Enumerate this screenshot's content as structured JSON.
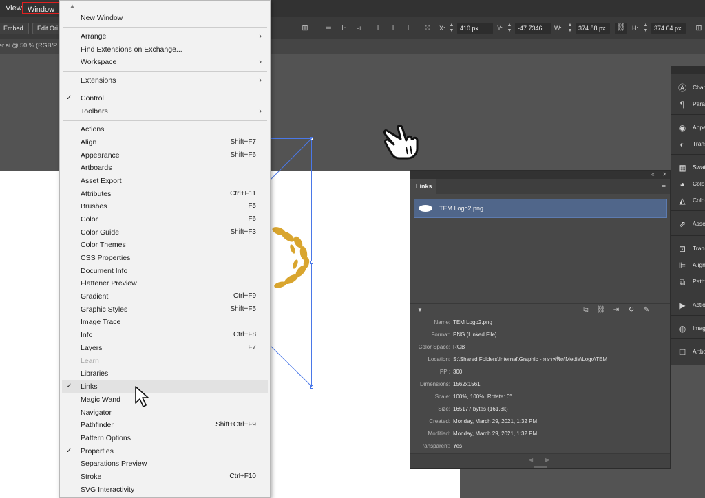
{
  "menubar": {
    "view_label": "View",
    "window_label": "Window"
  },
  "controlbar": {
    "embed_label": "Embed",
    "edit_original_label": "Edit Ori",
    "x_label": "X:",
    "x_value": "410 px",
    "y_label": "Y:",
    "y_value": "-47.7346 px",
    "w_label": "W:",
    "w_value": "374.88 px",
    "h_label": "H:",
    "h_value": "374.64 px"
  },
  "document": {
    "tab_label": "er.ai @ 50 % (RGB/P"
  },
  "window_menu": {
    "new_window": "New Window",
    "group1": [
      {
        "label": "Arrange",
        "submenu": true
      },
      {
        "label": "Find Extensions on Exchange...",
        "submenu": false
      },
      {
        "label": "Workspace",
        "submenu": true
      }
    ],
    "extensions": "Extensions",
    "control": "Control",
    "toolbars": "Toolbars",
    "panels": [
      {
        "label": "Actions",
        "shortcut": ""
      },
      {
        "label": "Align",
        "shortcut": "Shift+F7"
      },
      {
        "label": "Appearance",
        "shortcut": "Shift+F6"
      },
      {
        "label": "Artboards",
        "shortcut": ""
      },
      {
        "label": "Asset Export",
        "shortcut": ""
      },
      {
        "label": "Attributes",
        "shortcut": "Ctrl+F11"
      },
      {
        "label": "Brushes",
        "shortcut": "F5"
      },
      {
        "label": "Color",
        "shortcut": "F6"
      },
      {
        "label": "Color Guide",
        "shortcut": "Shift+F3"
      },
      {
        "label": "Color Themes",
        "shortcut": ""
      },
      {
        "label": "CSS Properties",
        "shortcut": ""
      },
      {
        "label": "Document Info",
        "shortcut": ""
      },
      {
        "label": "Flattener Preview",
        "shortcut": ""
      },
      {
        "label": "Gradient",
        "shortcut": "Ctrl+F9"
      },
      {
        "label": "Graphic Styles",
        "shortcut": "Shift+F5"
      },
      {
        "label": "Image Trace",
        "shortcut": ""
      },
      {
        "label": "Info",
        "shortcut": "Ctrl+F8"
      },
      {
        "label": "Layers",
        "shortcut": "F7"
      },
      {
        "label": "Learn",
        "shortcut": ""
      },
      {
        "label": "Libraries",
        "shortcut": ""
      },
      {
        "label": "Links",
        "shortcut": ""
      },
      {
        "label": "Magic Wand",
        "shortcut": ""
      },
      {
        "label": "Navigator",
        "shortcut": ""
      },
      {
        "label": "Pathfinder",
        "shortcut": "Shift+Ctrl+F9"
      },
      {
        "label": "Pattern Options",
        "shortcut": ""
      },
      {
        "label": "Properties",
        "shortcut": ""
      },
      {
        "label": "Separations Preview",
        "shortcut": ""
      },
      {
        "label": "Stroke",
        "shortcut": "Ctrl+F10"
      },
      {
        "label": "SVG Interactivity",
        "shortcut": ""
      }
    ]
  },
  "links_panel": {
    "tab_label": "Links",
    "file_name": "TEM Logo2.png",
    "info": [
      {
        "key": "Name:",
        "value": "TEM Logo2.png"
      },
      {
        "key": "Format:",
        "value": "PNG (Linked File)"
      },
      {
        "key": "Color Space:",
        "value": "RGB"
      },
      {
        "key": "Location:",
        "value": "S:\\Shared Folders\\Internal\\Graphic - กราฟฟิค\\Media\\Logo\\TEM"
      },
      {
        "key": "PPI:",
        "value": "300"
      },
      {
        "key": "Dimensions:",
        "value": "1562x1561"
      },
      {
        "key": "Scale:",
        "value": "100%, 100%; Rotate: 0°"
      },
      {
        "key": "Size:",
        "value": "165177 bytes (161.3k)"
      },
      {
        "key": "Created:",
        "value": "Monday, March 29, 2021, 1:32 PM"
      },
      {
        "key": "Modified:",
        "value": "Monday, March 29, 2021, 1:32 PM"
      },
      {
        "key": "Transparent:",
        "value": "Yes"
      }
    ]
  },
  "dock": {
    "items": [
      {
        "label": "Char",
        "icon": "character-icon"
      },
      {
        "label": "Parag",
        "icon": "paragraph-icon"
      },
      {
        "label": "Appe",
        "icon": "appearance-icon"
      },
      {
        "label": "Trans",
        "icon": "transparency-icon"
      },
      {
        "label": "Swat",
        "icon": "swatches-icon"
      },
      {
        "label": "Colo",
        "icon": "color-icon"
      },
      {
        "label": "Colo",
        "icon": "color-guide-icon"
      },
      {
        "label": "Asset",
        "icon": "asset-export-icon"
      },
      {
        "label": "Trans",
        "icon": "transform-icon"
      },
      {
        "label": "Align",
        "icon": "align-icon"
      },
      {
        "label": "Pathf",
        "icon": "pathfinder-icon"
      },
      {
        "label": "Actio",
        "icon": "actions-icon"
      },
      {
        "label": "Imag",
        "icon": "image-trace-icon"
      },
      {
        "label": "Artbo",
        "icon": "artboards-icon"
      }
    ]
  },
  "colors": {
    "menu_highlight": "#e2e2e2",
    "selection_blue": "#4a78e8",
    "links_row": "#50668a",
    "wreath_gold": "#d9a52e",
    "window_outline": "#e02020"
  }
}
